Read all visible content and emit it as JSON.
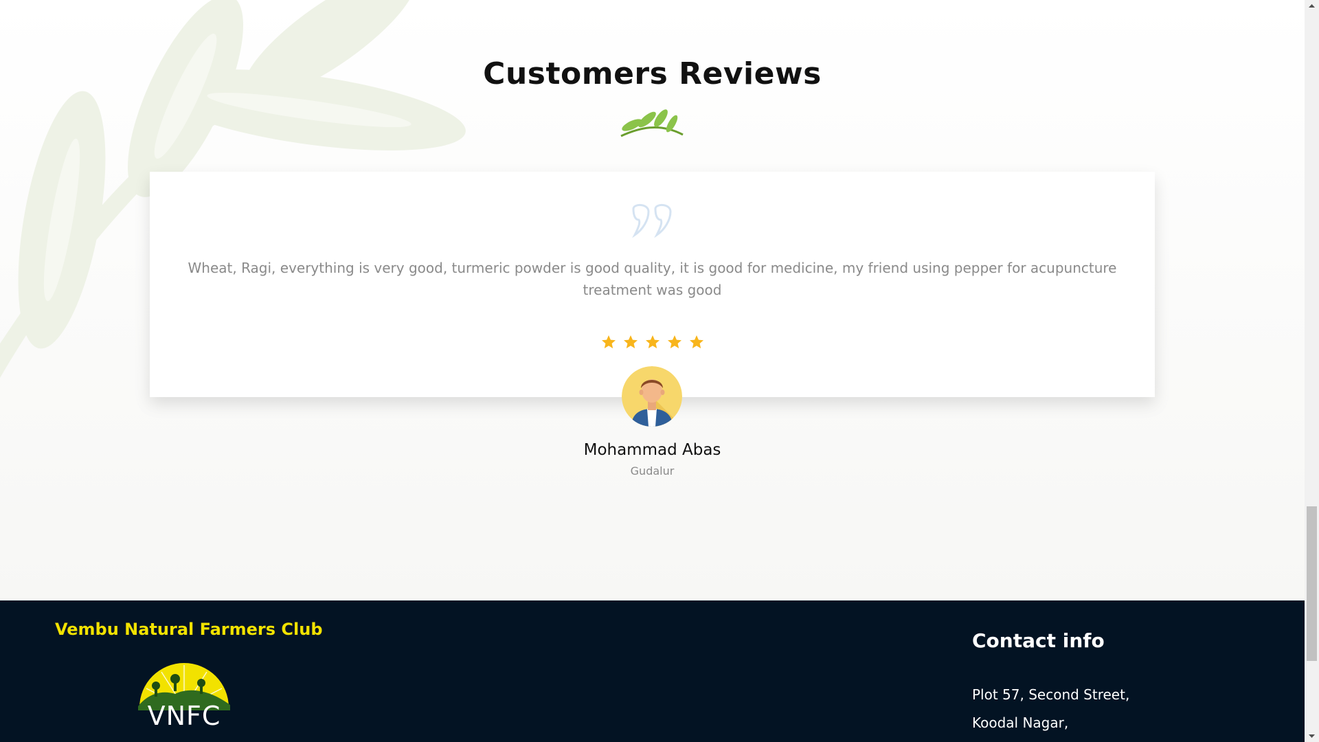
{
  "reviews": {
    "title": "Customers Reviews",
    "review": {
      "text": "Wheat, Ragi, everything is very good, turmeric powder is good quality, it is good for medicine, my friend using pepper for acupuncture treatment was good",
      "rating": 5,
      "reviewer_name": "Mohammad Abas",
      "reviewer_location": "Gudalur"
    }
  },
  "footer": {
    "brand": "Vembu Natural Farmers Club",
    "logo_text": "VNFC",
    "contact_title": "Contact info",
    "contact_lines": [
      "Plot 57, Second Street,",
      "Koodal Nagar,"
    ]
  },
  "colors": {
    "footer_bg": "#031323",
    "brand_yellow": "#f2e200",
    "star": "#f8b51c",
    "leaf_green": "#7cb342"
  }
}
